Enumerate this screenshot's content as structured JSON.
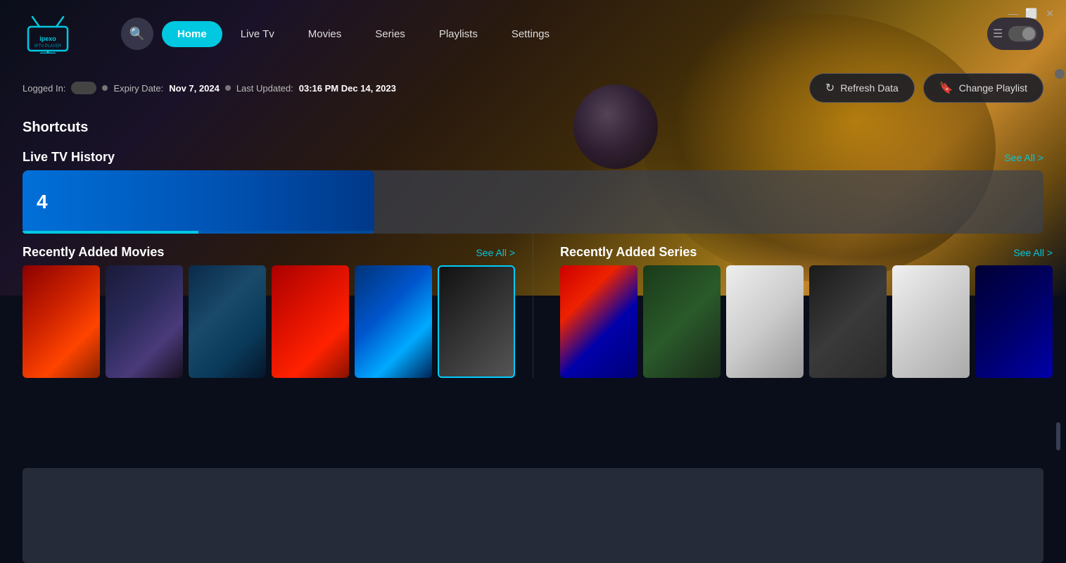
{
  "window": {
    "title": "IPEXO IPTV Player",
    "minimize_label": "—",
    "maximize_label": "⬜",
    "close_label": "✕"
  },
  "nav": {
    "search_placeholder": "Search...",
    "items": [
      {
        "id": "home",
        "label": "Home",
        "active": true
      },
      {
        "id": "live-tv",
        "label": "Live Tv",
        "active": false
      },
      {
        "id": "movies",
        "label": "Movies",
        "active": false
      },
      {
        "id": "series",
        "label": "Series",
        "active": false
      },
      {
        "id": "playlists",
        "label": "Playlists",
        "active": false
      },
      {
        "id": "settings",
        "label": "Settings",
        "active": false
      }
    ]
  },
  "status": {
    "logged_in_label": "Logged In:",
    "expiry_label": "Expiry Date:",
    "expiry_date": "Nov 7, 2024",
    "last_updated_label": "Last Updated:",
    "last_updated": "03:16 PM Dec 14, 2023"
  },
  "actions": {
    "refresh_label": "Refresh Data",
    "change_playlist_label": "Change Playlist"
  },
  "shortcuts": {
    "title": "Shortcuts"
  },
  "live_tv_history": {
    "title": "Live TV History",
    "see_all": "See All >",
    "channel_number": "4"
  },
  "recently_added_movies": {
    "title": "Recently Added Movies",
    "see_all": "See All >"
  },
  "recently_added_series": {
    "title": "Recently Added Series",
    "see_all": "See All >"
  }
}
